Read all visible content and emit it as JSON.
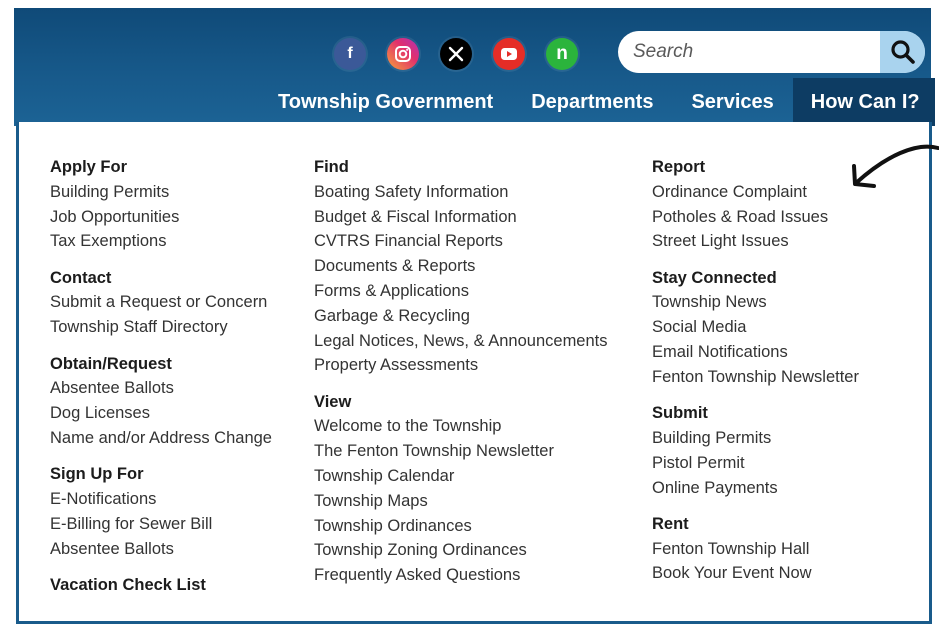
{
  "social": {
    "facebook": {
      "icon": "facebook-icon",
      "color": "#3b5998",
      "glyph": "f"
    },
    "instagram": {
      "icon": "instagram-icon",
      "color": "#e1306c"
    },
    "x": {
      "icon": "x-icon",
      "color": "#000000",
      "glyph": "𝕏"
    },
    "youtube": {
      "icon": "youtube-icon",
      "color": "#e52d27"
    },
    "nextdoor": {
      "icon": "nextdoor-icon",
      "color": "#2bb43c",
      "glyph": "n"
    }
  },
  "search": {
    "placeholder": "Search",
    "icon": "search-icon"
  },
  "nav": {
    "items": [
      "Township Government",
      "Departments",
      "Services",
      "How Can I?"
    ],
    "active": "How Can I?"
  },
  "menu": {
    "col1": [
      {
        "heading": "Apply For",
        "links": [
          "Building Permits",
          "Job Opportunities",
          "Tax Exemptions"
        ]
      },
      {
        "heading": "Contact",
        "links": [
          "Submit a Request or Concern",
          "Township Staff Directory"
        ]
      },
      {
        "heading": "Obtain/Request",
        "links": [
          "Absentee Ballots",
          "Dog Licenses",
          "Name and/or Address Change"
        ]
      },
      {
        "heading": "Sign Up For",
        "links": [
          "E-Notifications",
          "E-Billing for Sewer Bill",
          "Absentee Ballots"
        ]
      },
      {
        "heading": "Vacation Check List",
        "links": []
      }
    ],
    "col2": [
      {
        "heading": "Find",
        "links": [
          "Boating Safety Information",
          "Budget & Fiscal Information",
          "CVTRS Financial Reports",
          "Documents & Reports",
          "Forms & Applications",
          "Garbage & Recycling",
          "Legal Notices, News, & Announcements",
          "Property Assessments"
        ]
      },
      {
        "heading": "View",
        "links": [
          "Welcome to the Township",
          "The Fenton Township Newsletter",
          "Township Calendar",
          "Township Maps",
          "Township Ordinances",
          "Township Zoning Ordinances",
          "Frequently Asked Questions"
        ]
      }
    ],
    "col3": [
      {
        "heading": "Report",
        "links": [
          "Ordinance Complaint",
          "Potholes & Road Issues",
          "Street Light Issues"
        ]
      },
      {
        "heading": "Stay Connected",
        "links": [
          "Township News",
          "Social Media",
          "Email Notifications",
          "Fenton Township Newsletter"
        ]
      },
      {
        "heading": "Submit",
        "links": [
          "Building Permits",
          "Pistol Permit",
          "Online Payments"
        ]
      },
      {
        "heading": "Rent",
        "links": [
          "Fenton Township Hall",
          "Book Your Event Now"
        ]
      }
    ]
  },
  "annotation": {
    "icon": "hand-drawn-arrow-icon"
  }
}
